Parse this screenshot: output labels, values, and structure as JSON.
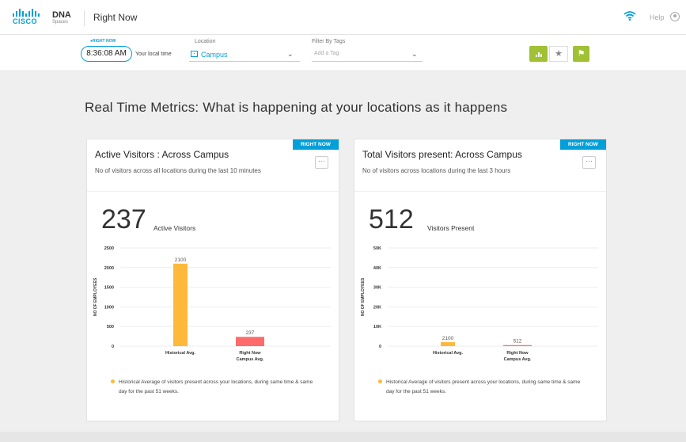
{
  "header": {
    "logo_text": "CISCO",
    "product_main": "DNA",
    "product_sub": "Spaces",
    "page_name": "Right Now",
    "help_label": "Help"
  },
  "filters": {
    "right_now_tag": "●RIGHT NOW",
    "clock_time": "8:36:08 AM",
    "local_time_label": "Your local time",
    "location_label": "Location",
    "location_value": "Campus",
    "tags_label": "Filter By Tags",
    "tags_placeholder": "Add a Tag"
  },
  "headline": "Real Time Metrics: What is happening at your locations as it happens",
  "colors": {
    "accent": "#049fd9",
    "green": "#9fc133",
    "bar_hist": "#ffb93a",
    "bar_now": "#ff6b6b"
  },
  "cards": [
    {
      "badge": "RIGHT NOW",
      "title": "Active Visitors : Across Campus",
      "description": "No of visitors across all locations  during the last 10 minutes",
      "big_number": "237",
      "big_label": "Active Visitors",
      "legend": "Historical Average of visitors present across your locations, during same time & same day for the past 51 weeks.",
      "chart_data": {
        "type": "bar",
        "categories": [
          "Historical Avg.",
          "Right Now Campus Avg."
        ],
        "category_lines": [
          [
            "Historical Avg."
          ],
          [
            "Right Now",
            "Campus Avg."
          ]
        ],
        "values": [
          2100,
          237
        ],
        "value_labels": [
          "2100",
          "237"
        ],
        "ylabel": "NO OF EMPLOYEES",
        "ylim": [
          0,
          2500
        ],
        "yticks": [
          0,
          500,
          1000,
          1500,
          2000,
          2500
        ],
        "ytick_labels": [
          "0",
          "500",
          "1000",
          "1500",
          "2000",
          "2500"
        ],
        "bar_colors": [
          "#ffb93a",
          "#ff6b6b"
        ],
        "grid": true
      }
    },
    {
      "badge": "RIGHT NOW",
      "title": "Total Visitors present: Across Campus",
      "description": "No of visitors across locations during the last 3 hours",
      "big_number": "512",
      "big_label": "Visitors Present",
      "legend": "Historical Average of visitors present across your locations, during same time & same day for the past 51 weeks.",
      "chart_data": {
        "type": "bar",
        "categories": [
          "Historical Avg.",
          "Right Now Campus Avg."
        ],
        "category_lines": [
          [
            "Historical Avg."
          ],
          [
            "Right Now",
            "Campus Avg."
          ]
        ],
        "values": [
          2100,
          512
        ],
        "value_labels": [
          "2100",
          "512"
        ],
        "ylabel": "NO OF EMPLOYEES",
        "ylim": [
          0,
          50000
        ],
        "yticks": [
          0,
          10000,
          20000,
          30000,
          40000,
          50000
        ],
        "ytick_labels": [
          "0",
          "10K",
          "20K",
          "30K",
          "40K",
          "50K"
        ],
        "bar_colors": [
          "#ffb93a",
          "#ff6b6b"
        ],
        "grid": true
      }
    }
  ]
}
